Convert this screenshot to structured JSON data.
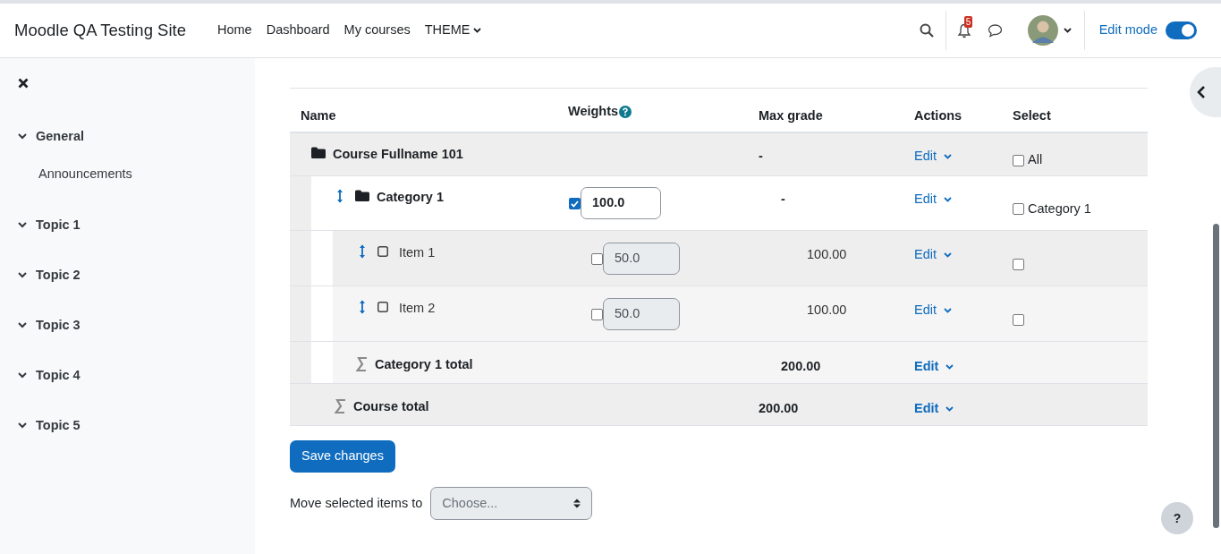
{
  "navbar": {
    "brand": "Moodle QA Testing Site",
    "links": [
      {
        "label": "Home",
        "dropdown": false
      },
      {
        "label": "Dashboard",
        "dropdown": false
      },
      {
        "label": "My courses",
        "dropdown": false
      },
      {
        "label": "THEME",
        "dropdown": true
      }
    ],
    "notification_count": "5",
    "edit_mode": {
      "label": "Edit mode",
      "on": true
    }
  },
  "sidebar": {
    "items": [
      {
        "label": "General",
        "expanded": true,
        "children": [
          {
            "label": "Announcements"
          }
        ]
      },
      {
        "label": "Topic 1",
        "expanded": true
      },
      {
        "label": "Topic 2",
        "expanded": true
      },
      {
        "label": "Topic 3",
        "expanded": true
      },
      {
        "label": "Topic 4",
        "expanded": true
      },
      {
        "label": "Topic 5",
        "expanded": true
      }
    ]
  },
  "table": {
    "columns": [
      "Name",
      "Weights",
      "Max grade",
      "Actions",
      "Select"
    ],
    "rows": [
      {
        "kind": "course",
        "name": "Course Fullname 101",
        "max_grade": "-",
        "action": "Edit",
        "select": {
          "checked": false,
          "label": "All"
        },
        "children": [
          {
            "kind": "category",
            "name": "Category 1",
            "weight": {
              "checked": true,
              "value": "100.0",
              "disabled": false
            },
            "max_grade": "-",
            "action": "Edit",
            "select": {
              "checked": false,
              "label": "Category 1"
            },
            "children": [
              {
                "kind": "item",
                "name": "Item 1",
                "weight": {
                  "checked": false,
                  "value": "50.0",
                  "disabled": true
                },
                "max_grade": "100.00",
                "action": "Edit",
                "select": {
                  "checked": false
                }
              },
              {
                "kind": "item",
                "name": "Item 2",
                "weight": {
                  "checked": false,
                  "value": "50.0",
                  "disabled": true
                },
                "max_grade": "100.00",
                "action": "Edit",
                "select": {
                  "checked": false
                }
              },
              {
                "kind": "category_total",
                "name": "Category 1 total",
                "max_grade": "200.00",
                "action": "Edit"
              }
            ]
          },
          {
            "kind": "course_total",
            "name": "Course total",
            "max_grade": "200.00",
            "action": "Edit"
          }
        ]
      }
    ]
  },
  "save_button": "Save changes",
  "move": {
    "label": "Move selected items to",
    "placeholder": "Choose..."
  },
  "help_button": "?"
}
